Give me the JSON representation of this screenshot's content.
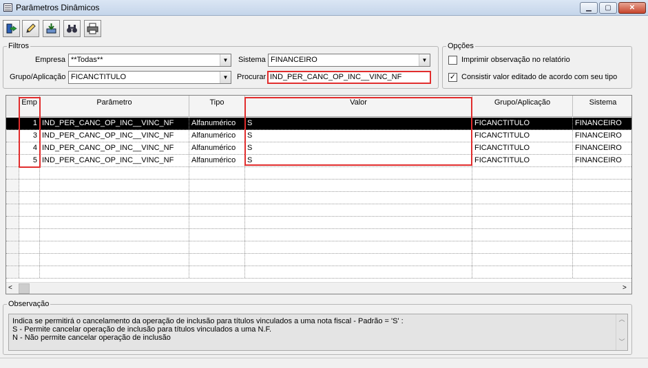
{
  "window": {
    "title": "Parâmetros Dinâmicos"
  },
  "filters": {
    "legend": "Filtros",
    "empresa_label": "Empresa",
    "empresa_value": "**Todas**",
    "sistema_label": "Sistema",
    "sistema_value": "FINANCEIRO",
    "grupo_label": "Grupo/Aplicação",
    "grupo_value": "FICANCTITULO",
    "procurar_label": "Procurar",
    "procurar_value": "IND_PER_CANC_OP_INC__VINC_NF"
  },
  "options": {
    "legend": "Opções",
    "imprimir_label": "Imprimir observação no relatório",
    "imprimir_checked": false,
    "consistir_label": "Consistir valor editado de acordo com seu tipo",
    "consistir_checked": true,
    "check_mark": "✓"
  },
  "grid": {
    "columns": [
      "Emp",
      "Parâmetro",
      "Tipo",
      "Valor",
      "Grupo/Aplicação",
      "Sistema"
    ],
    "rows": [
      {
        "emp": "1",
        "parametro": "IND_PER_CANC_OP_INC__VINC_NF",
        "tipo": "Alfanumérico",
        "valor": "S",
        "grupo": "FICANCTITULO",
        "sistema": "FINANCEIRO"
      },
      {
        "emp": "3",
        "parametro": "IND_PER_CANC_OP_INC__VINC_NF",
        "tipo": "Alfanumérico",
        "valor": "S",
        "grupo": "FICANCTITULO",
        "sistema": "FINANCEIRO"
      },
      {
        "emp": "4",
        "parametro": "IND_PER_CANC_OP_INC__VINC_NF",
        "tipo": "Alfanumérico",
        "valor": "S",
        "grupo": "FICANCTITULO",
        "sistema": "FINANCEIRO"
      },
      {
        "emp": "5",
        "parametro": "IND_PER_CANC_OP_INC__VINC_NF",
        "tipo": "Alfanumérico",
        "valor": "S",
        "grupo": "FICANCTITULO",
        "sistema": "FINANCEIRO"
      }
    ],
    "selected_row": 0
  },
  "observacao": {
    "legend": "Observação",
    "lines": [
      "Indica se permitirá o cancelamento da operação de inclusão para títulos vinculados a uma nota fiscal - Padrão = 'S' :",
      "S - Permite cancelar operação de inclusão para títulos vinculados a uma N.F.",
      "N - Não permite cancelar operação de inclusão"
    ]
  },
  "icons": [
    "app-icon",
    "exit-icon",
    "edit-pencil-icon",
    "export-icon",
    "binoculars-icon",
    "printer-icon"
  ],
  "colors": {
    "highlight": "#e12c2c",
    "selected_row_bg": "#000000"
  }
}
